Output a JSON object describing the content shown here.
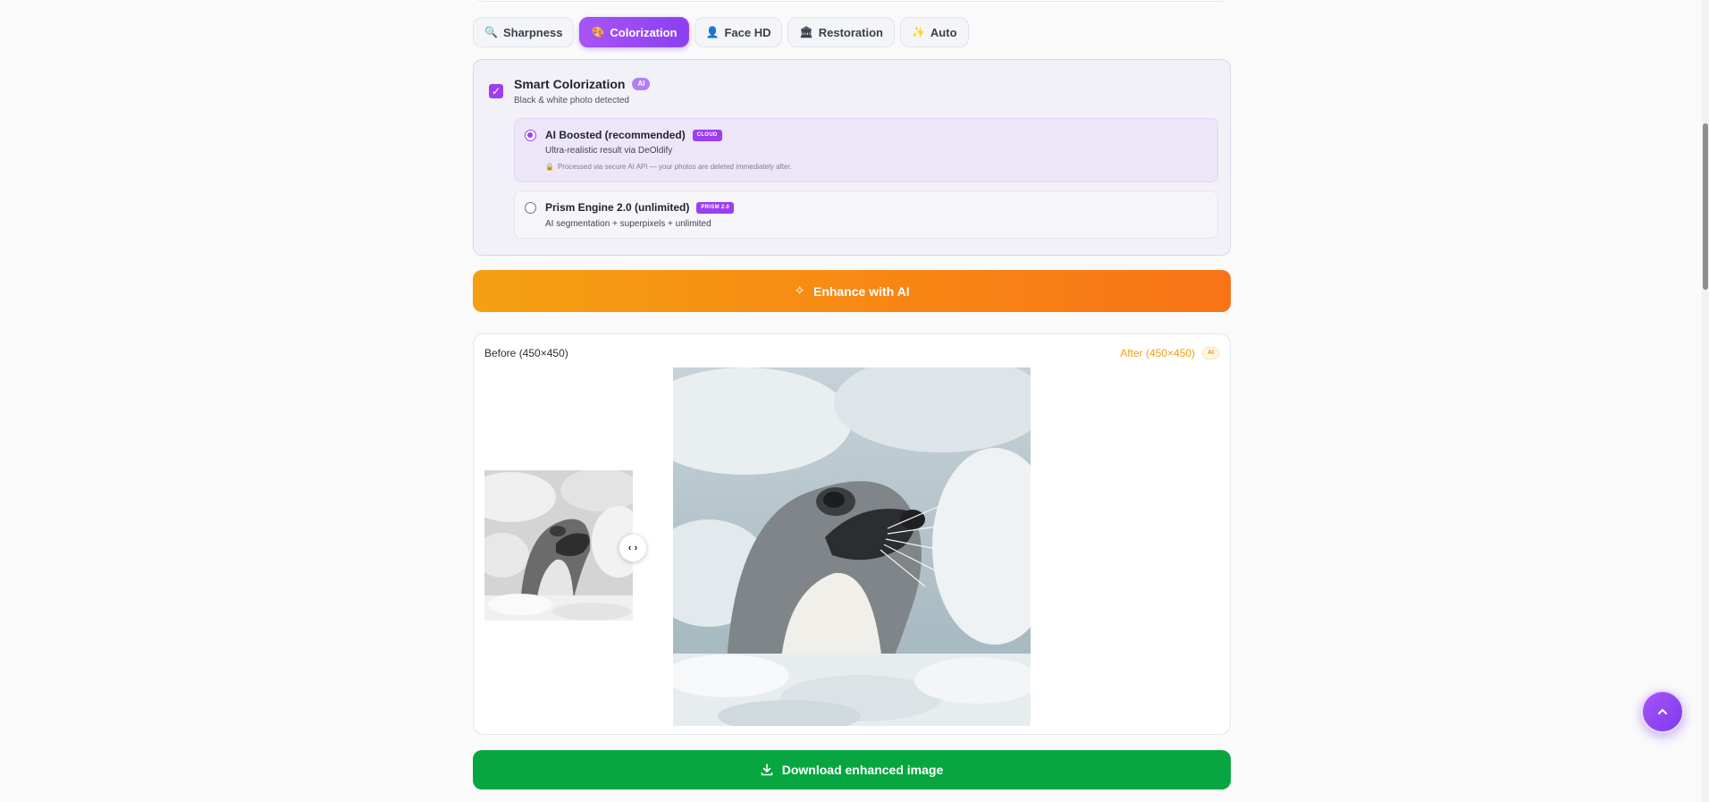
{
  "tabs": [
    {
      "label": "Sharpness",
      "icon": "magnifier-icon",
      "glyph": "🔍",
      "active": false
    },
    {
      "label": "Colorization",
      "icon": "palette-icon",
      "glyph": "🎨",
      "active": true
    },
    {
      "label": "Face HD",
      "icon": "person-icon",
      "glyph": "👤",
      "active": false
    },
    {
      "label": "Restoration",
      "icon": "museum-icon",
      "glyph": "🏛",
      "active": false
    },
    {
      "label": "Auto",
      "icon": "sparkles-icon",
      "glyph": "✨",
      "active": false
    }
  ],
  "colorization": {
    "checked": true,
    "title": "Smart Colorization",
    "badge": "AI",
    "subtitle": "Black & white photo detected",
    "options": [
      {
        "title": "AI Boosted (recommended)",
        "tag": "CLOUD",
        "description": "Ultra-realistic result via DeOldify",
        "note": "Processed via secure AI API — your photos are deleted immediately after.",
        "selected": true
      },
      {
        "title": "Prism Engine 2.0 (unlimited)",
        "tag": "PRISM 2.0",
        "description": "AI segmentation + superpixels + unlimited",
        "selected": false
      }
    ]
  },
  "enhance_button": {
    "label": "Enhance with AI",
    "icon": "sparkle-icon"
  },
  "comparison": {
    "before_label": "Before (450×450)",
    "after_label": "After (450×450)",
    "after_badge": "AI",
    "handle_glyph": "‹ ›"
  },
  "download_button": {
    "label": "Download enhanced image",
    "icon": "download-icon"
  },
  "scroll_top": {
    "icon": "chevron-up-icon"
  },
  "colors": {
    "accent_purple": "#9b3ff0",
    "enhance_orange": "#f97316",
    "download_green": "#07a640",
    "after_orange": "#f59e0b"
  }
}
